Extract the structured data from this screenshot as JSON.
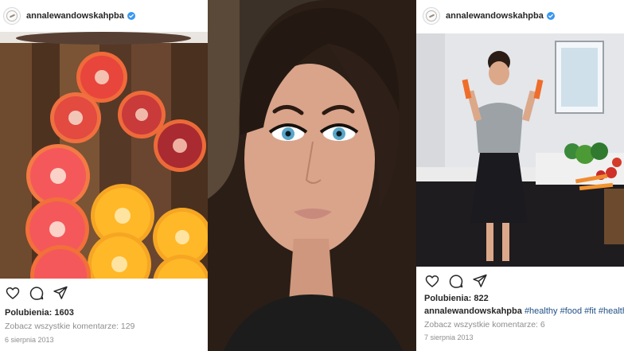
{
  "posts": [
    {
      "username": "annalewandowskahpba",
      "likes_text": "Polubienia: 1603",
      "comments_text": "Zobacz wszystkie komentarze: 129",
      "date_text": "6 sierpnia 2013"
    },
    {
      "username": "annalewandowskahpba",
      "likes_text": "Polubienia: 822",
      "caption_user": "annalewandowskahpba",
      "caption_tags": "#healthy #food #fit #healthy f",
      "comments_text": "Zobacz wszystkie komentarze: 6",
      "date_text": "7 sierpnia 2013"
    }
  ],
  "icons": [
    "profile-avatar-icon",
    "verified-badge-icon",
    "heart-icon",
    "comment-icon",
    "share-icon"
  ],
  "colors": {
    "verified_blue": "#3897f0",
    "hashtag_blue": "#1f4f85",
    "meta_gray": "#8e8e8e",
    "text_dark": "#262626"
  }
}
